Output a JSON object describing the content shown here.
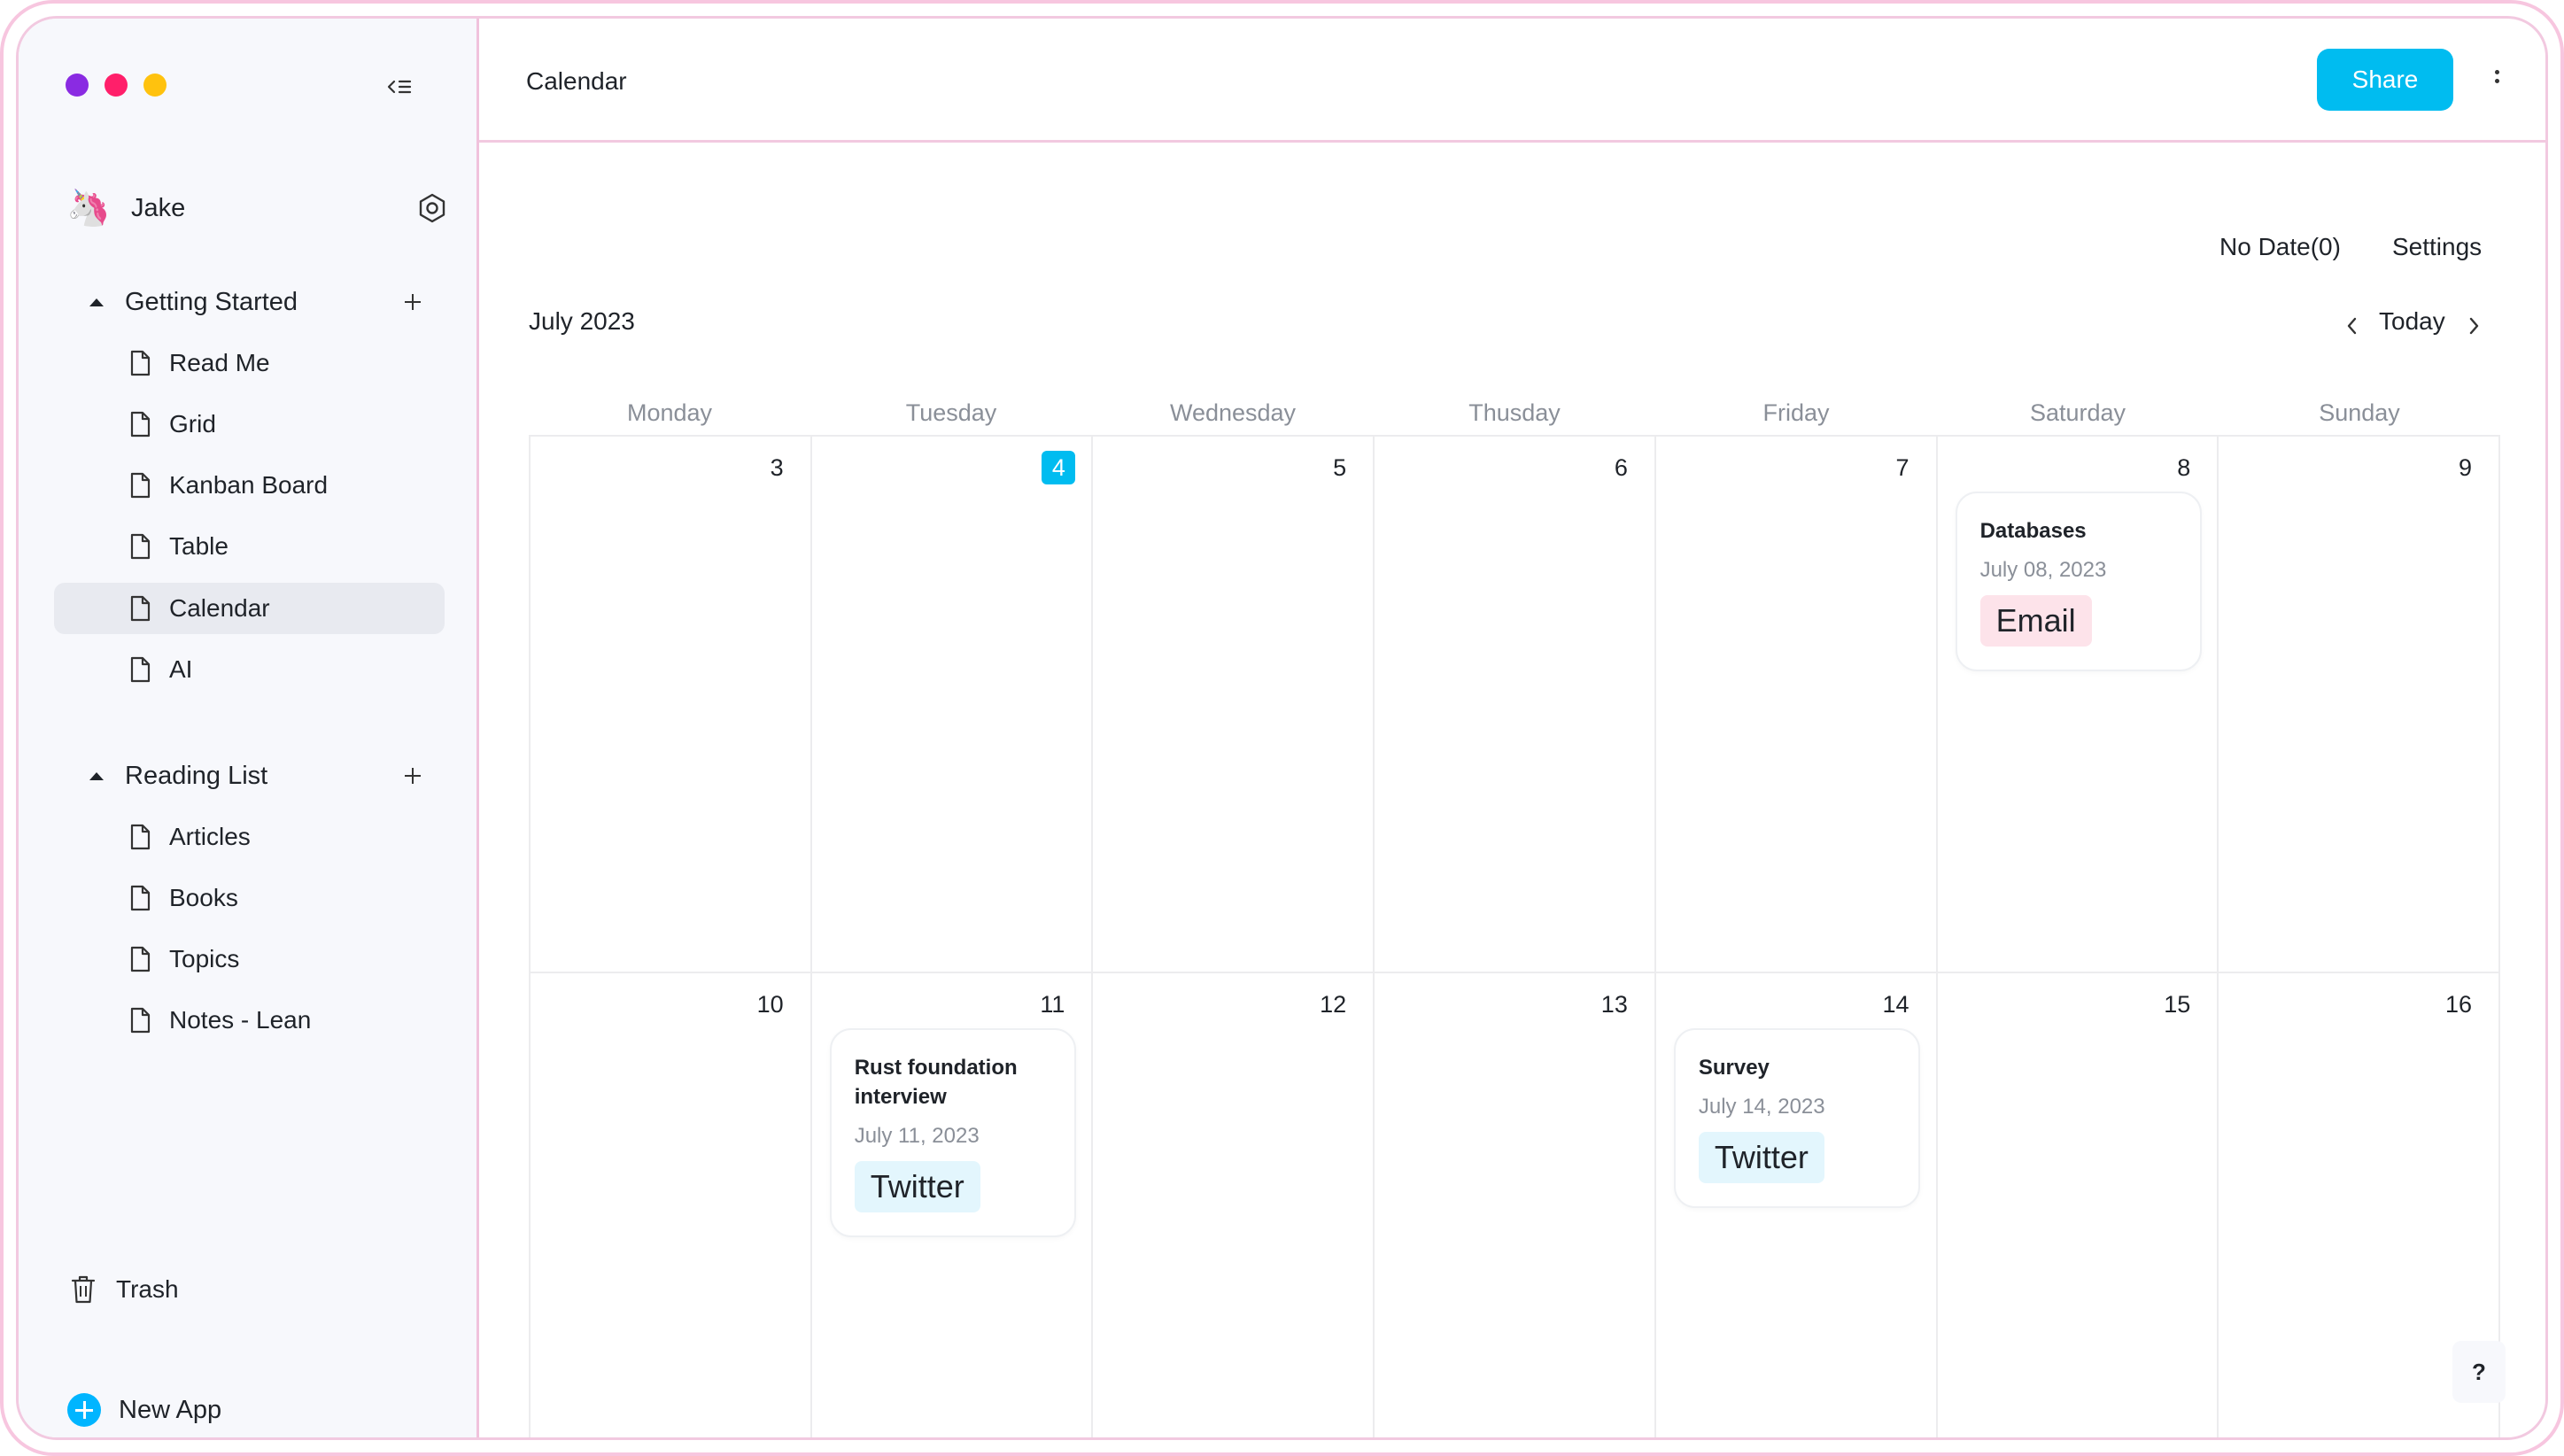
{
  "window": {
    "traffic_colors": [
      "#8a2be2",
      "#ff1f6a",
      "#ffc20e"
    ]
  },
  "sidebar": {
    "user": {
      "name": "Jake",
      "avatar": "🦄"
    },
    "sections": [
      {
        "label": "Getting Started",
        "items": [
          {
            "label": "Read Me"
          },
          {
            "label": "Grid"
          },
          {
            "label": "Kanban Board"
          },
          {
            "label": "Table"
          },
          {
            "label": "Calendar",
            "active": true
          },
          {
            "label": "AI"
          }
        ]
      },
      {
        "label": "Reading List",
        "items": [
          {
            "label": "Articles"
          },
          {
            "label": "Books"
          },
          {
            "label": "Topics"
          },
          {
            "label": "Notes - Lean"
          }
        ]
      }
    ],
    "trash_label": "Trash",
    "new_app_label": "New App"
  },
  "header": {
    "title": "Calendar",
    "share_label": "Share"
  },
  "calendar": {
    "no_date_label": "No Date(0)",
    "settings_label": "Settings",
    "month_label": "July 2023",
    "today_label": "Today",
    "weekdays": [
      "Monday",
      "Tuesday",
      "Wednesday",
      "Thusday",
      "Friday",
      "Saturday",
      "Sunday"
    ],
    "weeks": [
      {
        "days": [
          "3",
          "4",
          "5",
          "6",
          "7",
          "8",
          "9"
        ]
      },
      {
        "days": [
          "10",
          "11",
          "12",
          "13",
          "14",
          "15",
          "16"
        ]
      }
    ],
    "today": "4",
    "events": [
      {
        "title": "Databases",
        "date": "July 08, 2023",
        "tag": "Email"
      },
      {
        "title": "Rust foundation interview",
        "date": "July 11, 2023",
        "tag": "Twitter"
      },
      {
        "title": "Survey",
        "date": "July 14, 2023",
        "tag": "Twitter"
      }
    ],
    "colors": {
      "accent": "#00bcf0",
      "email_tag": "#fde3ea",
      "twitter_tag": "#e3f6fd"
    }
  },
  "help_label": "?"
}
